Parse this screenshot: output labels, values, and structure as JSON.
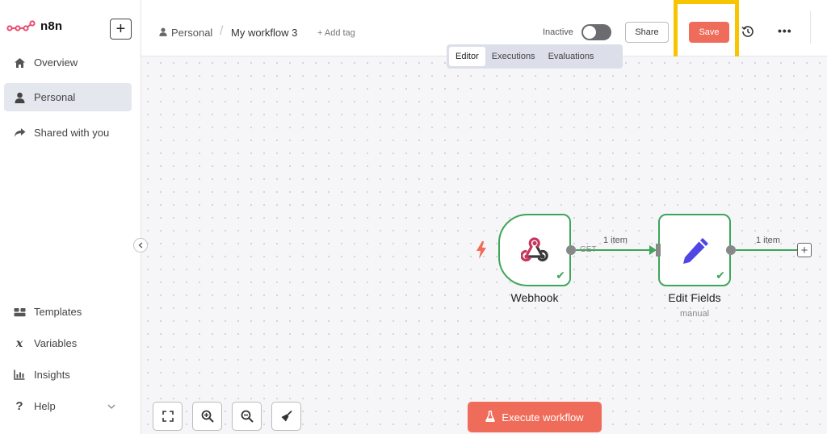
{
  "app": {
    "name": "n8n"
  },
  "sidebar": {
    "top_items": [
      {
        "label": "Overview",
        "icon": "home-icon"
      },
      {
        "label": "Personal",
        "icon": "user-icon",
        "active": true
      },
      {
        "label": "Shared with you",
        "icon": "share-icon"
      }
    ],
    "bottom_items": [
      {
        "label": "Templates",
        "icon": "templates-icon"
      },
      {
        "label": "Variables",
        "icon": "variables-icon"
      },
      {
        "label": "Insights",
        "icon": "insights-icon"
      },
      {
        "label": "Help",
        "icon": "help-icon"
      }
    ]
  },
  "header": {
    "project": "Personal",
    "separator": "/",
    "workflow_name": "My workflow 3",
    "add_tag": "+ Add tag",
    "status_label": "Inactive",
    "active": false,
    "share_label": "Share",
    "save_label": "Save",
    "more": "•••"
  },
  "tabs": [
    {
      "label": "Editor",
      "active": true
    },
    {
      "label": "Executions",
      "active": false
    },
    {
      "label": "Evaluations",
      "active": false
    }
  ],
  "canvas": {
    "nodes": [
      {
        "title": "Webhook",
        "subtitle": "",
        "method": "GET",
        "status": "success"
      },
      {
        "title": "Edit Fields",
        "subtitle": "manual",
        "status": "success"
      }
    ],
    "edges": [
      {
        "label": "1 item"
      },
      {
        "label": "1 item"
      }
    ],
    "execute_label": "Execute workflow"
  },
  "colors": {
    "accent": "#ef6c5a",
    "success": "#3fa55b",
    "highlight": "#f7c400",
    "edit_icon": "#4f46e5"
  }
}
